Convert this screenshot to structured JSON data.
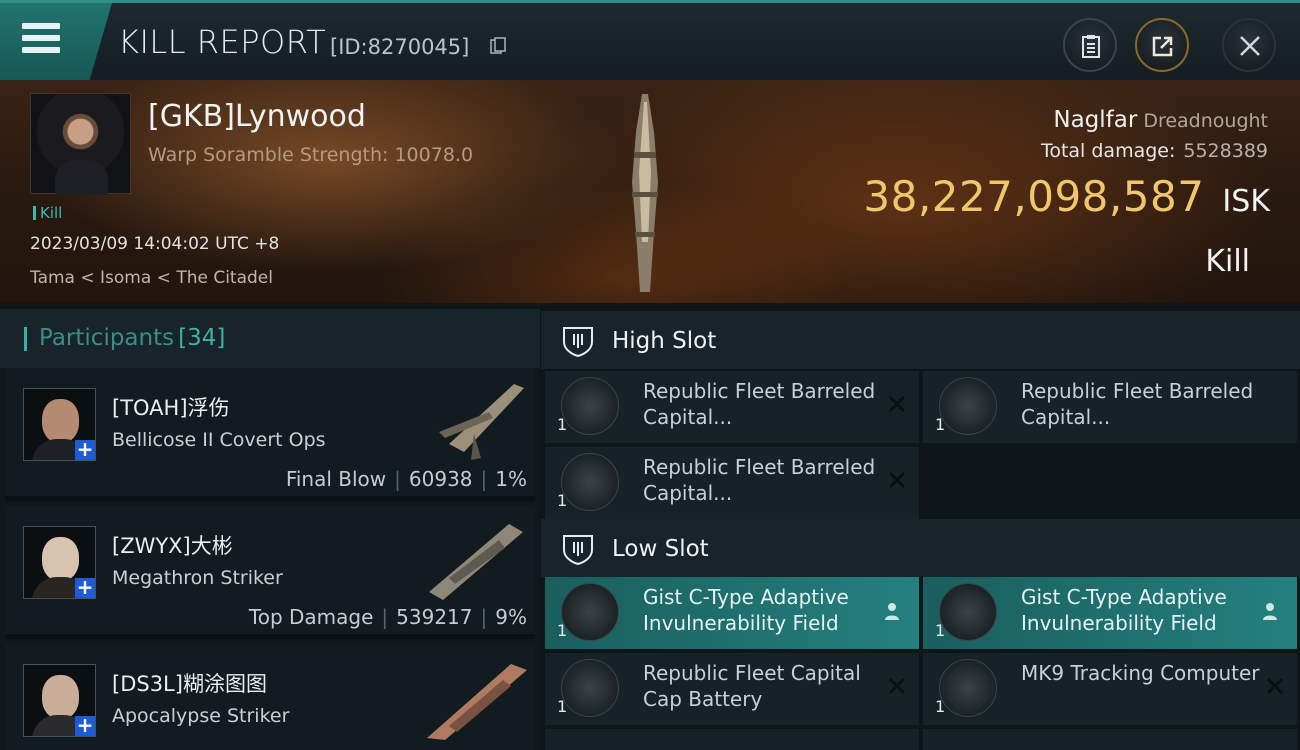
{
  "header": {
    "title": "KILL REPORT",
    "report_id": "[ID:8270045]",
    "icons": [
      "menu-icon",
      "copy-icon",
      "clipboard-icon",
      "share-icon",
      "close-icon"
    ],
    "accent": "#2f8f8a"
  },
  "victim": {
    "name": "[GKB]Lynwood",
    "stat_line": "Warp Soramble Strength: 10078.0",
    "tag": "Kill",
    "datetime": "2023/03/09 14:04:02 UTC +8",
    "location": "Tama < Isoma < The Citadel",
    "ship_name": "Naglfar",
    "ship_class": "Dreadnought",
    "damage_label": "Total damage:",
    "damage_value": "5528389",
    "isk_value": "38,227,098,587",
    "isk_unit": "ISK",
    "result": "Kill",
    "isk_color": "#f1c76d"
  },
  "participants": {
    "title": "Participants",
    "count": "[34]",
    "rows": [
      {
        "name": "[TOAH]浮伤",
        "ship": "Bellicose II Covert Ops",
        "role": "Final Blow",
        "damage": "60938",
        "percent": "1%"
      },
      {
        "name": "[ZWYX]大彬",
        "ship": "Megathron Striker",
        "role": "Top Damage",
        "damage": "539217",
        "percent": "9%"
      },
      {
        "name": "[DS3L]糊涂图图",
        "ship": "Apocalypse Striker",
        "role": "",
        "damage": "",
        "percent": ""
      }
    ]
  },
  "fitting": {
    "high_slot": {
      "title": "High Slot",
      "modules": [
        {
          "qty": "1",
          "name": "Republic Fleet Barreled Capital..."
        },
        {
          "qty": "1",
          "name": "Republic Fleet Barreled Capital..."
        },
        {
          "qty": "1",
          "name": "Republic Fleet Barreled Capital..."
        }
      ]
    },
    "low_slot": {
      "title": "Low Slot",
      "modules": [
        {
          "qty": "1",
          "name": "Gist C-Type Adaptive Invulnerability Field"
        },
        {
          "qty": "1",
          "name": "Gist C-Type Adaptive Invulnerability Field"
        },
        {
          "qty": "1",
          "name": "Republic Fleet Capital Cap Battery"
        },
        {
          "qty": "1",
          "name": "MK9 Tracking Computer"
        }
      ]
    },
    "highlight_color": "#24807f"
  }
}
